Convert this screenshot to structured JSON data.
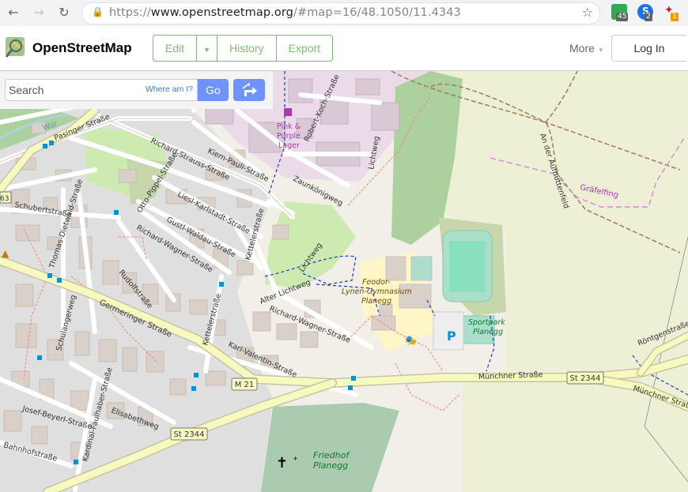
{
  "browser": {
    "url_scheme": "https://",
    "url_host": "www.openstreetmap.org",
    "url_rest": "/#map=16/48.1050/11.4343",
    "extensions": [
      {
        "name": "green-extension-icon",
        "badge": "45",
        "color": "#34a853",
        "badge_color": "#5f6368"
      },
      {
        "name": "skype-extension-icon",
        "badge": "2",
        "color": "#1a73e8",
        "badge_color": "#5f6368"
      },
      {
        "name": "satellite-extension-icon",
        "badge": "1",
        "color": "#ffffff",
        "badge_color": "#f29900"
      }
    ]
  },
  "header": {
    "brand": "OpenStreetMap",
    "edit": "Edit",
    "history": "History",
    "export": "Export",
    "more": "More",
    "login": "Log In"
  },
  "search": {
    "placeholder": "Search",
    "where_am_i": "Where am I?",
    "go": "Go"
  },
  "map": {
    "labels": {
      "pink_purple_1": "Pink &",
      "pink_purple_2": "Purple",
      "pink_purple_3": "Lager",
      "robert_koch": "Robert-Koch-Straße",
      "kiem_pauli": "Kiem-Pauli-Straße",
      "richard_strauss": "Richard-Strauss-Straße",
      "pasinger": "Pasinger Straße",
      "wur": "Wür",
      "zaunkoenig": "Zaunkönigweg",
      "lichtweg_top": "Lichtweg",
      "lichtweg_mid": "Lichtweg",
      "am_aufhuttenfeld": "An der Aufhüttenfeld",
      "graefelfing": "Gräfelfing",
      "otto_pippel": "Otto-Pippel-Straße",
      "liesl_karlstadt": "Liesl-Karlstadt-Straße",
      "gustl_waldau": "Gustl-Waldau-Straße",
      "schubert": "Schubertstraße",
      "thomas_dietwald": "Thomas-Dietwald-Straße",
      "richard_wagner_1": "Richard-Wagner-Straße",
      "kettelerstr_1": "Kettelerstraße",
      "rudolf": "Rudolfstraße",
      "alter_lichtweg": "Alter Lichtweg",
      "richard_wagner_2": "Richard-Wagner-Straße",
      "germeringer": "Germeringer Straße",
      "schulanger": "Schulangerweg",
      "kettelerstr_2": "Kettelerstraße",
      "karl_valentin": "Karl-Valentin-Straße",
      "feodor_1": "Feodor-",
      "feodor_2": "Lynen-Gymnasium",
      "feodor_3": "Planegg",
      "sportpark_1": "Sportpark",
      "sportpark_2": "Planegg",
      "muenchner_1": "Münchner Straße",
      "muenchner_2": "Münchner Straße",
      "roentgen": "Röntgenstraße",
      "josef_beyerl": "Josef-Beyerl-Straße",
      "kardinal": "Kardinal-Faulhaber-Straße",
      "elisabeth": "Elisabethweg",
      "bahnhof": "Bahnhofstraße",
      "friedhof_1": "Friedhof",
      "friedhof_2": "Planegg",
      "num_63": "63",
      "ref_m21": "M 21",
      "ref_st2344_a": "St 2344",
      "ref_st2344_b": "St 2344",
      "parking": "P"
    }
  }
}
